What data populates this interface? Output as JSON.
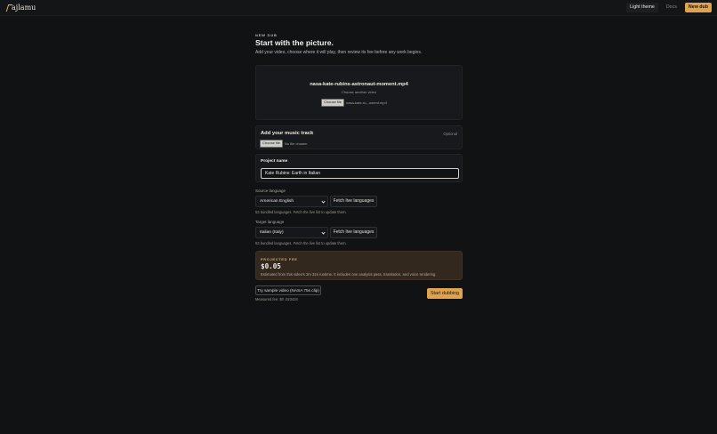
{
  "app": {
    "logo_text": "ajlamu"
  },
  "header": {
    "theme_label": "Light theme",
    "docs_label": "Docs",
    "new_dub_label": "New dub"
  },
  "hero": {
    "eyebrow": "NEW DUB",
    "title": "Start with the picture.",
    "subtitle": "Add your video, choose where it will play, then review its fee before any work begins."
  },
  "video": {
    "file_name": "nasa-kate-rubins-astronaut-moment.mp4",
    "choose_another": "Choose another video",
    "choose_file_label": "Choose file",
    "chosen_file_short": "nasa-kate-ru...oment.mp4"
  },
  "music": {
    "title": "Add your music track",
    "optional_label": "Optional",
    "choose_file_label": "Choose file",
    "no_file_label": "No file chosen"
  },
  "project": {
    "label": "Project name",
    "value": "Kate Rubins: Earth in Italian"
  },
  "source_language": {
    "label": "Source language",
    "selected": "American English",
    "fetch_label": "Fetch live languages",
    "hint": "53 bundled languages. Fetch the live list to update them."
  },
  "target_language": {
    "label": "Target language",
    "selected": "Italian (Italy)",
    "fetch_label": "Fetch live languages",
    "hint": "53 bundled languages. Fetch the live list to update them."
  },
  "fee": {
    "eyebrow": "PROJECTED FEE",
    "value": "$0.05",
    "detail": "Estimated from this video's 2m 32s runtime. It includes one analysis pass, translation, and voice rendering."
  },
  "actions": {
    "sample_label": "Try sample video (NASA 75s clip)",
    "measured_fee": "Measured fee: $0 .023434",
    "start_label": "Start dubbing"
  },
  "colors": {
    "accent": "#e0a24c",
    "background": "#111214",
    "fee_background": "#32281e"
  }
}
